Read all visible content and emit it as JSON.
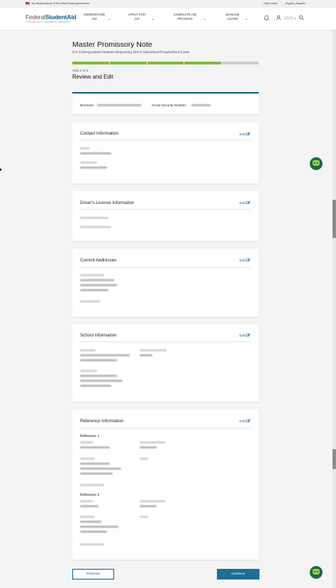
{
  "gov_banner": {
    "official_text": "An official website of the United States government",
    "help_center": "Help Center",
    "languages": "English | Español"
  },
  "header": {
    "logo_primary": "Federal",
    "logo_secondary": "StudentAid",
    "logo_subtitle": "An OFFICE of the U.S. DEPARTMENT of EDUCATION",
    "nav": [
      {
        "label": "UNDERSTAND\nAID"
      },
      {
        "label": "APPLY FOR\nAID"
      },
      {
        "label": "COMPLETE AID\nPROCESS"
      },
      {
        "label": "MANAGE\nLOANS"
      }
    ],
    "icons": {
      "notifications": "bell-icon",
      "account": "user-icon",
      "search": "search-icon"
    }
  },
  "page": {
    "title": "Master Promissory Note",
    "subtitle": "For Undergraduate Students Requesting Direct Subsidized/Unsubsidized Loans",
    "progress": {
      "current_step": 4,
      "total_steps": 5,
      "fraction_complete": 0.8
    },
    "step_label": "Step 4 of 5",
    "section_heading": "Review and Edit"
  },
  "borrower": {
    "borrower_label": "Borrower:",
    "ssn_label": "Social Security Number:"
  },
  "cards": {
    "contact": {
      "title": "Contact Information",
      "edit": "Edit"
    },
    "license": {
      "title": "Driver's License Information",
      "edit": "Edit"
    },
    "addresses": {
      "title": "Current Addresses",
      "edit": "Edit"
    },
    "school": {
      "title": "School Information",
      "edit": "Edit"
    },
    "reference": {
      "title": "Reference Information",
      "edit": "Edit",
      "ref1": "Reference 1",
      "ref2": "Reference 2"
    }
  },
  "actions": {
    "previous": "Previous",
    "continue": "Continue"
  },
  "colors": {
    "brand_blue": "#0b5a8a",
    "progress_done": "#7fba3e",
    "progress_todo": "#c9cdd0",
    "button_primary": "#1f6d94"
  }
}
